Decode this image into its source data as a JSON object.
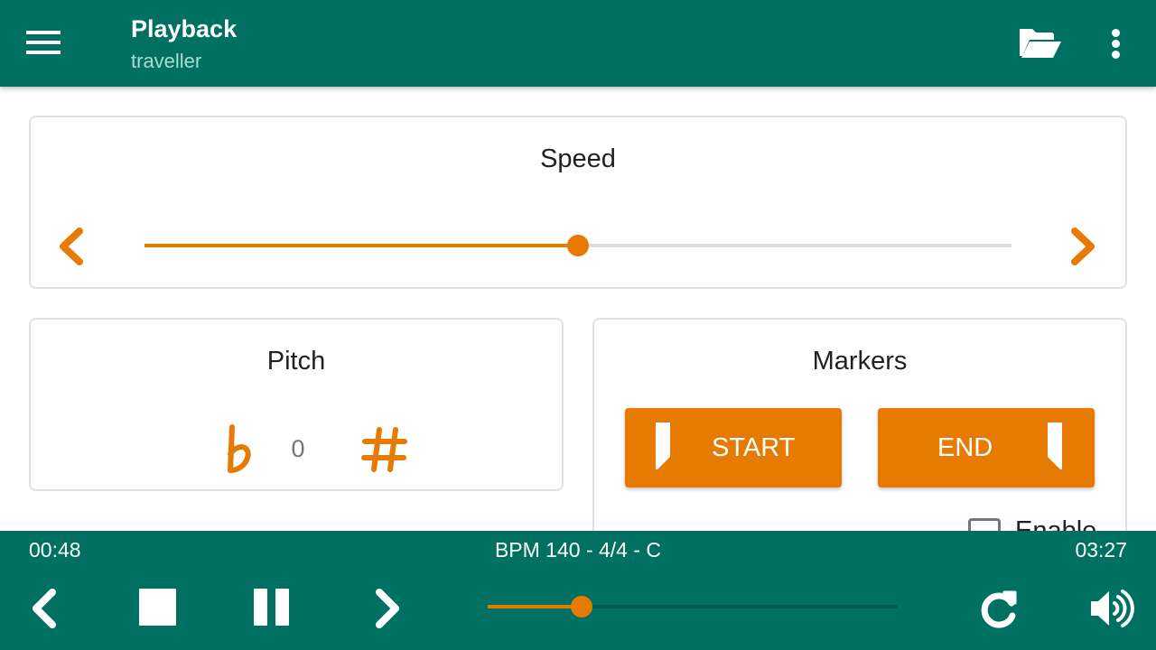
{
  "appbar": {
    "title": "Playback",
    "subtitle": "traveller",
    "icons": [
      "menu-icon",
      "folder-open-icon",
      "more-vert-icon"
    ]
  },
  "speed": {
    "title": "Speed",
    "slider_value_fraction": 0.5,
    "decrease_icon": "chevron-left-icon",
    "increase_icon": "chevron-right-icon"
  },
  "pitch": {
    "title": "Pitch",
    "value": "0",
    "flat_symbol": "b",
    "sharp_symbol": "#"
  },
  "markers": {
    "title": "Markers",
    "start_label": "START",
    "end_label": "END",
    "enable_label": "Enable",
    "enable_checked": false
  },
  "player": {
    "current_time": "00:48",
    "total_time": "03:27",
    "song_info": "BPM 140 - 4/4 - C",
    "progress_fraction": 0.23,
    "controls": [
      "previous-icon",
      "stop-icon",
      "pause-icon",
      "next-icon",
      "repeat-icon",
      "volume-icon"
    ]
  },
  "colors": {
    "primary": "#007063",
    "accent": "#e77a00",
    "subtitle": "#a8dcd4"
  }
}
